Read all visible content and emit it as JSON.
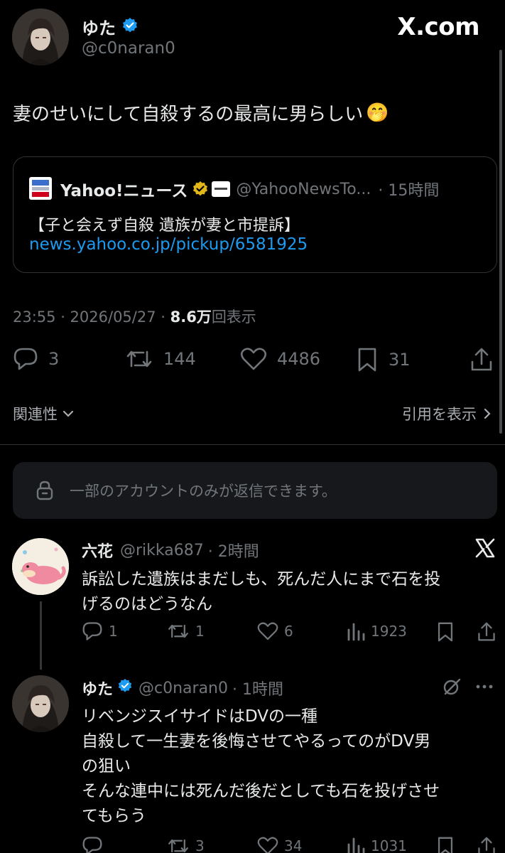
{
  "brand": "X.com",
  "main_post": {
    "author_name": "ゆた",
    "author_handle": "@c0naran0",
    "text": "妻のせいにして自殺するの最高に男らしい",
    "emoji": "🤭",
    "quote": {
      "source_name": "Yahoo!ニュース",
      "source_handle": "@YahooNewsTo...",
      "time": "· 15時間",
      "headline": "【子と会えず自殺 遺族が妻と市提訴】",
      "link": "news.yahoo.co.jp/pickup/6581925"
    },
    "timestamp": "23:55 · 2026/05/27 · ",
    "views_count": "8.6万",
    "views_label": "回表示",
    "replies": "3",
    "reposts": "144",
    "likes": "4486",
    "bookmarks": "31"
  },
  "related_label": "関連性",
  "quotes_label": "引用を表示",
  "reply_notice": "一部のアカウントのみが返信できます。",
  "reply1": {
    "author_name": "六花",
    "author_handle": "@rikka687",
    "time": "· 2時間",
    "line1": "訴訟した遺族はまだしも、死んだ人にまで石を投",
    "line2": "げるのはどうなん",
    "replies": "1",
    "reposts": "1",
    "likes": "6",
    "views": "1923"
  },
  "reply2": {
    "author_name": "ゆた",
    "author_handle": "@c0naran0",
    "time": "· 1時間",
    "line1": "リベンジスイサイドはDVの一種",
    "line2": "自殺して一生妻を後悔させてやるってのがDV男",
    "line3": "の狙い",
    "line4": "そんな連中には死んだ後だとしても石を投げさせ",
    "line5": "てもらう",
    "reposts": "3",
    "likes": "34",
    "views": "1031"
  },
  "colors": {
    "accent": "#1d9bf0",
    "muted": "#71767b",
    "background": "#000000",
    "verified_gold": "#e2b719"
  }
}
